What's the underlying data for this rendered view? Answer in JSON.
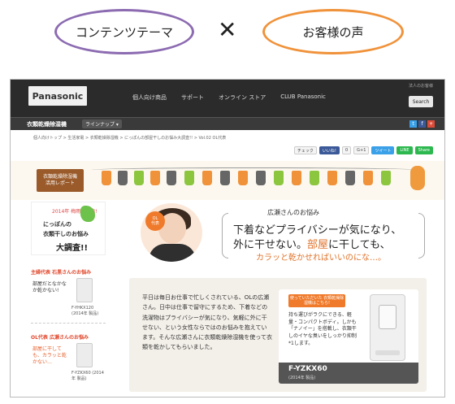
{
  "labels": {
    "left_oval": "コンテンツテーマ",
    "times": "✕",
    "right_oval": "お客様の声"
  },
  "header": {
    "logo": "Panasonic",
    "nav": [
      "個人向け商品",
      "サポート",
      "オンライン ストア",
      "CLUB Panasonic"
    ],
    "util": "法人のお客様",
    "search_label": "Search",
    "subtitle": "衣類乾燥除湿機",
    "lineup": "ラインナップ ▾",
    "social": [
      "t",
      "f",
      "+"
    ]
  },
  "breadcrumb": "個人向けトップ > 生活家電 > 衣類乾燥除湿機 > にっぽんの部屋干しのお悩み大調査!! > Vol.02 OL代表",
  "share": [
    "チェック",
    "いいね!",
    "0",
    "G+1",
    "ツイート",
    "LINE",
    "Share"
  ],
  "board": [
    "衣類乾燥除湿機",
    "活用レポート"
  ],
  "promo": {
    "year": "2014年 梅雨に実施!",
    "line1": "にっぽんの",
    "line2": "衣類干しのお悩み",
    "line3": "大調査!!"
  },
  "side_cards": [
    {
      "head": "主婦代表 石黒さんのお悩み",
      "text": "部屋だとなかなか乾かない!",
      "caption": "F-YHKX120 (2014年 製品)"
    },
    {
      "head": "OL代表 広瀬さんのお悩み",
      "text": "部屋に干しても、カラッと乾かない…",
      "caption": "F-YZKX60 (2014年 製品)"
    }
  ],
  "persona_badge": [
    "OL",
    "代表"
  ],
  "worry": {
    "title": "広瀬さんのお悩み",
    "line1": "下着などプライバシーが気になり、",
    "line2a": "外に干せない。",
    "line2b": "部屋",
    "line2c": "に干しても、",
    "line3": "カラッと乾かせればいいのにな…。"
  },
  "info": {
    "text": "平日は毎日お仕事で忙しくされている、OLの広瀬さん。日中は仕事で留守にするため、下着などの洗濯物はプライバシーが気になり、気軽に外に干せない、という女性ならではのお悩みを抱えています。そんな広瀬さんに衣類乾燥除湿機を使って衣類を乾かしてもらいました。",
    "tab": "使っていただいた 衣類乾燥除湿機はこちら!",
    "product_text": "持ち運びがラクにできる、軽量・コンパクトボディ。しかも「ナノイー」を搭載し、衣類干しのイヤな臭いをしっかり抑制*1します。",
    "model": "F-YZKX60",
    "model_year": "(2014年 製品)"
  },
  "colors": {
    "purple_oval": "#8c6bb1",
    "orange_oval": "#f0923a",
    "accent": "#f07a2b",
    "header_bg": "#2b2b2b"
  }
}
